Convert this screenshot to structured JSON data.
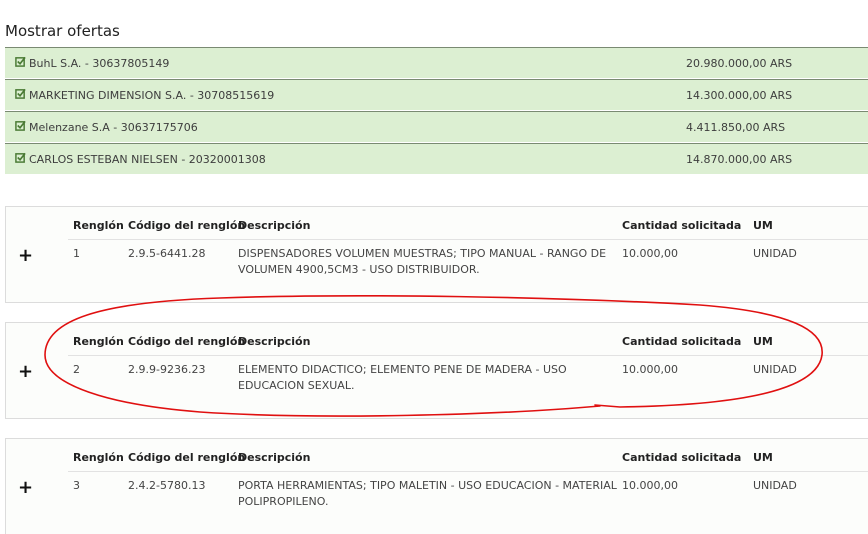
{
  "page": {
    "title": "Mostrar ofertas"
  },
  "offers": [
    {
      "name": "BuhL S.A. - 30637805149",
      "amount": "20.980.000,00 ARS",
      "icon": "checkbox-checked-icon"
    },
    {
      "name": "MARKETING DIMENSION S.A. - 30708515619",
      "amount": "14.300.000,00 ARS",
      "icon": "checkbox-checked-icon"
    },
    {
      "name": "Melenzane S.A - 30637175706",
      "amount": "4.411.850,00 ARS",
      "icon": "checkbox-checked-icon"
    },
    {
      "name": "CARLOS ESTEBAN NIELSEN - 20320001308",
      "amount": "14.870.000,00 ARS",
      "icon": "checkbox-checked-icon"
    }
  ],
  "table_headers": {
    "renglon": "Renglón",
    "codigo": "Código del renglón",
    "descripcion": "Descripción",
    "cantidad": "Cantidad solicitada",
    "um": "UM"
  },
  "items": [
    {
      "expand": "+",
      "renglon": "1",
      "codigo": "2.9.5-6441.28",
      "descripcion": "DISPENSADORES VOLUMEN MUESTRAS; TIPO MANUAL - RANGO DE VOLUMEN 4900,5CM3 - USO DISTRIBUIDOR.",
      "cantidad": "10.000,00",
      "um": "UNIDAD"
    },
    {
      "expand": "+",
      "renglon": "2",
      "codigo": "2.9.9-9236.23",
      "descripcion": "ELEMENTO DIDACTICO; ELEMENTO PENE DE MADERA - USO EDUCACION SEXUAL.",
      "cantidad": "10.000,00",
      "um": "UNIDAD"
    },
    {
      "expand": "+",
      "renglon": "3",
      "codigo": "2.4.2-5780.13",
      "descripcion": "PORTA HERRAMIENTAS; TIPO MALETIN - USO EDUCACION - MATERIAL POLIPROPILENO.",
      "cantidad": "10.000,00",
      "um": "UNIDAD"
    }
  ],
  "colors": {
    "offer_bg": "#dcefd2",
    "check": "#4a7a34",
    "annotation": "#e01010"
  }
}
